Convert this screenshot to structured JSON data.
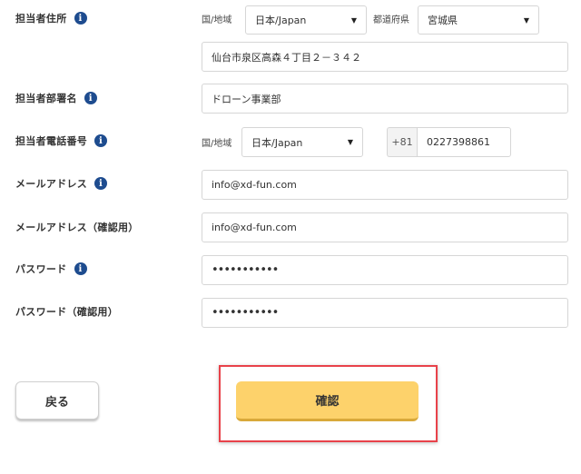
{
  "form": {
    "address": {
      "label": "担当者住所",
      "country_label": "国/地域",
      "country_value": "日本/Japan",
      "prefecture_label": "都道府県",
      "prefecture_value": "宮城県",
      "street_value": "仙台市泉区高森４丁目２－３４２"
    },
    "department": {
      "label": "担当者部署名",
      "value": "ドローン事業部"
    },
    "phone": {
      "label": "担当者電話番号",
      "country_label": "国/地域",
      "country_value": "日本/Japan",
      "prefix": "+81",
      "value": "0227398861"
    },
    "email": {
      "label": "メールアドレス",
      "value": "info@xd-fun.com"
    },
    "email_confirm": {
      "label": "メールアドレス（確認用）",
      "value": "info@xd-fun.com"
    },
    "password": {
      "label": "パスワード",
      "value": "•••••••••••"
    },
    "password_confirm": {
      "label": "パスワード（確認用）",
      "value": "•••••••••••"
    }
  },
  "buttons": {
    "back_label": "戻る",
    "confirm_label": "確認"
  },
  "icons": {
    "info": "i",
    "caret": "▼"
  },
  "colors": {
    "info_icon": "#1e4c8f",
    "confirm_button": "#fdd26b",
    "highlight_border": "#e8424a"
  }
}
